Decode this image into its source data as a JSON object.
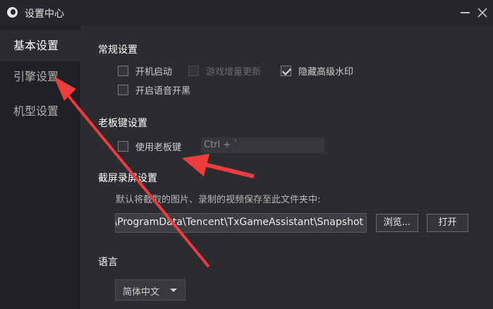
{
  "window": {
    "title": "设置中心"
  },
  "sidebar": {
    "items": [
      {
        "label": "基本设置",
        "active": true
      },
      {
        "label": "引擎设置",
        "active": false
      },
      {
        "label": "机型设置",
        "active": false
      }
    ]
  },
  "general": {
    "title": "常规设置",
    "options": [
      {
        "label": "开机启动",
        "checked": false,
        "disabled": false
      },
      {
        "label": "游戏增量更新",
        "checked": false,
        "disabled": true
      },
      {
        "label": "隐藏高级水印",
        "checked": true,
        "disabled": false
      },
      {
        "label": "开启语音开黑",
        "checked": false,
        "disabled": false
      }
    ]
  },
  "boss_key": {
    "title": "老板键设置",
    "option": {
      "label": "使用老板键",
      "checked": false
    },
    "hotkey": "Ctrl + `"
  },
  "screenshot": {
    "title": "截屏录屏设置",
    "description": "默认将截取的图片、录制的视频保存至此文件夹中:",
    "path": "C:\\ProgramData\\Tencent\\TxGameAssistant\\Snapshot",
    "browse_label": "浏览...",
    "open_label": "打开"
  },
  "language": {
    "title": "语言",
    "selected": "简体中文"
  },
  "colors": {
    "background": "#2b2b30",
    "sidebar": "#212125",
    "annotation_arrow": "#ee3b3b"
  },
  "icons": [
    "app-logo-icon",
    "minimize-icon",
    "close-icon",
    "checkmark-icon",
    "chevron-down-icon"
  ]
}
